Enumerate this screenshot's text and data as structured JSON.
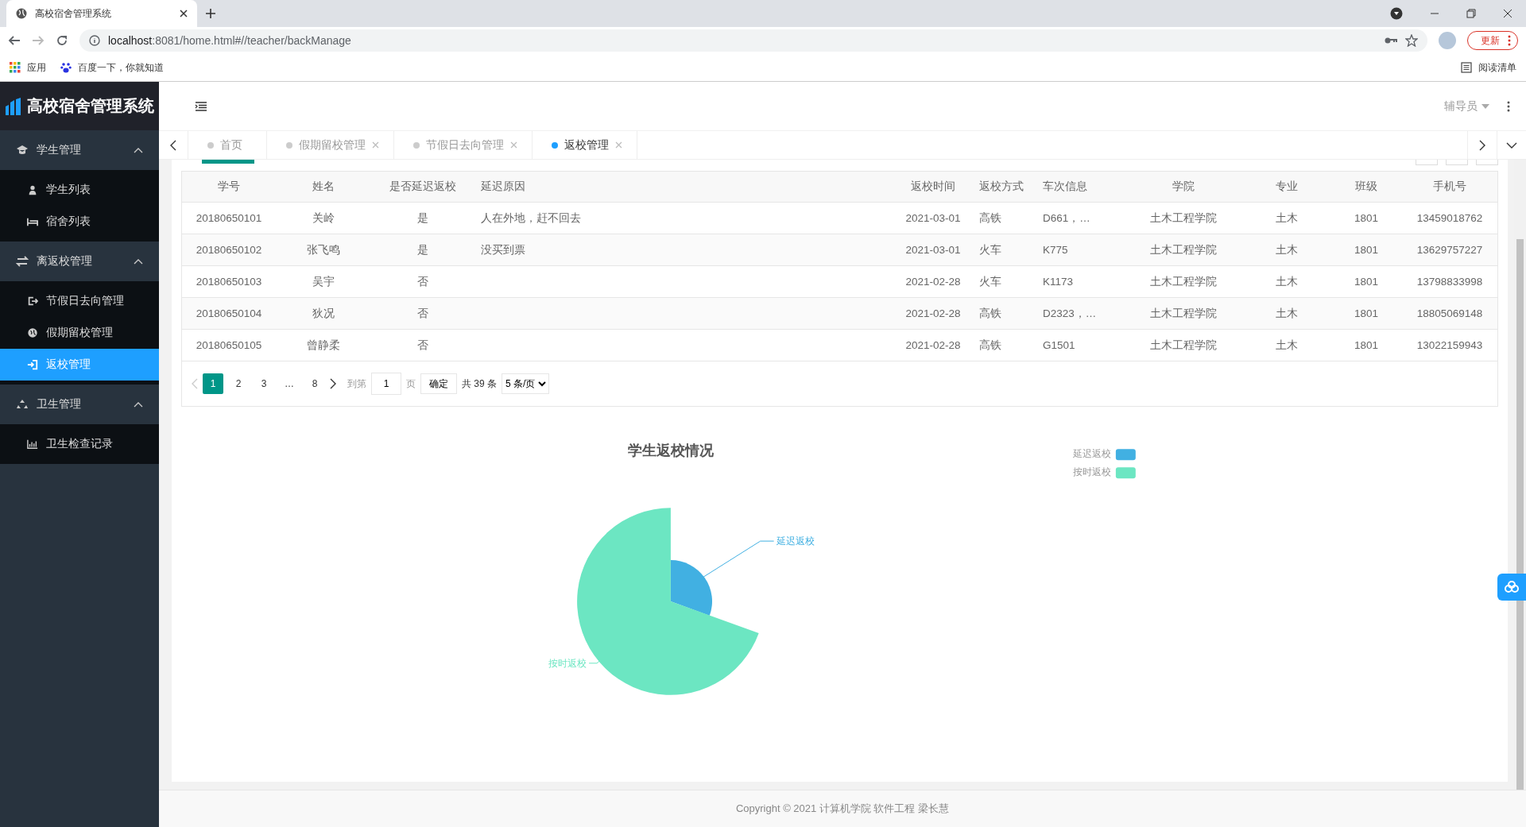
{
  "browser": {
    "tab_title": "高校宿舍管理系统",
    "url_host": "localhost",
    "url_path": ":8081/home.html#//teacher/backManage",
    "bookmarks": [
      "应用",
      "百度一下，你就知道"
    ],
    "reading_list": "阅读清单",
    "update_button": "更新"
  },
  "app": {
    "logo": "高校宿舍管理系统",
    "user": "辅导员",
    "sidebar": [
      {
        "label": "学生管理",
        "expanded": true,
        "children": [
          {
            "label": "学生列表",
            "selected": false
          },
          {
            "label": "宿舍列表",
            "selected": false
          }
        ]
      },
      {
        "label": "离返校管理",
        "expanded": true,
        "children": [
          {
            "label": "节假日去向管理",
            "selected": false
          },
          {
            "label": "假期留校管理",
            "selected": false
          },
          {
            "label": "返校管理",
            "selected": true
          }
        ]
      },
      {
        "label": "卫生管理",
        "expanded": true,
        "children": [
          {
            "label": "卫生检查记录",
            "selected": false
          }
        ]
      }
    ],
    "tabs": [
      {
        "label": "首页",
        "selected": false,
        "closable": false
      },
      {
        "label": "假期留校管理",
        "selected": false,
        "closable": true
      },
      {
        "label": "节假日去向管理",
        "selected": false,
        "closable": true
      },
      {
        "label": "返校管理",
        "selected": true,
        "closable": true
      }
    ],
    "table": {
      "columns": [
        "学号",
        "姓名",
        "是否延迟返校",
        "延迟原因",
        "返校时间",
        "返校方式",
        "车次信息",
        "学院",
        "专业",
        "班级",
        "手机号"
      ],
      "rows": [
        [
          "20180650101",
          "关岭",
          "是",
          "人在外地，赶不回去",
          "2021-03-01",
          "高铁",
          "D661，…",
          "土木工程学院",
          "土木",
          "1801",
          "13459018762"
        ],
        [
          "20180650102",
          "张飞鸣",
          "是",
          "没买到票",
          "2021-03-01",
          "火车",
          "K775",
          "土木工程学院",
          "土木",
          "1801",
          "13629757227"
        ],
        [
          "20180650103",
          "吴宇",
          "否",
          "",
          "2021-02-28",
          "火车",
          "K1173",
          "土木工程学院",
          "土木",
          "1801",
          "13798833998"
        ],
        [
          "20180650104",
          "狄况",
          "否",
          "",
          "2021-02-28",
          "高铁",
          "D2323，…",
          "土木工程学院",
          "土木",
          "1801",
          "18805069148"
        ],
        [
          "20180650105",
          "曾静柔",
          "否",
          "",
          "2021-02-28",
          "高铁",
          "G1501",
          "土木工程学院",
          "土木",
          "1801",
          "13022159943"
        ]
      ]
    },
    "pagination": {
      "pages": [
        {
          "label": "1",
          "selected": true
        },
        {
          "label": "2",
          "selected": false
        },
        {
          "label": "3",
          "selected": false
        },
        {
          "label": "…",
          "selected": false
        },
        {
          "label": "8",
          "selected": false
        }
      ],
      "goto_label": "到第",
      "goto_value": "1",
      "page_unit": "页",
      "confirm": "确定",
      "total": "共 39 条",
      "page_size": "5 条/页"
    },
    "chart": {
      "title": "学生返校情况",
      "legend": [
        {
          "label": "延迟返校",
          "color": "#41b0e2"
        },
        {
          "label": "按时返校",
          "color": "#6ce6c2"
        }
      ],
      "slice_labels": [
        "延迟返校",
        "按时返校"
      ]
    },
    "footer": "Copyright © 2021 计算机学院 软件工程 梁长慧"
  }
}
